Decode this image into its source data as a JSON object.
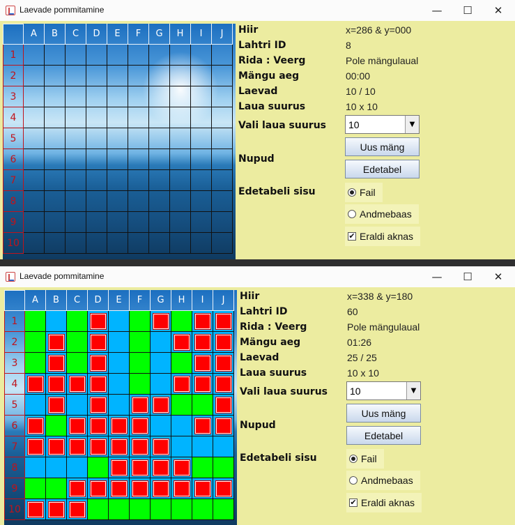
{
  "title": "Laevade pommitamine",
  "window_controls": {
    "minimize": "—",
    "maximize": "☐",
    "close": "✕"
  },
  "columns": [
    "A",
    "B",
    "C",
    "D",
    "E",
    "F",
    "G",
    "H",
    "I",
    "J"
  ],
  "rows": [
    "1",
    "2",
    "3",
    "4",
    "5",
    "6",
    "7",
    "8",
    "9",
    "10"
  ],
  "labels": {
    "mouse": "Hiir",
    "cell_id": "Lahtri ID",
    "row_col": "Rida : Veerg",
    "game_time": "Mängu aeg",
    "ships": "Laevad",
    "board_size": "Laua suurus",
    "choose_size": "Vali laua suurus",
    "buttons": "Nupud",
    "leaderboard_content": "Edetabeli sisu"
  },
  "buttons": {
    "new_game": "Uus mäng",
    "leaderboard": "Edetabel"
  },
  "options": {
    "file": "Fail",
    "database": "Andmebaas",
    "separate_window": "Eraldi aknas"
  },
  "windows": [
    {
      "mouse": "x=286 & y=000",
      "cell_id": "8",
      "row_col": "Pole mängulaual",
      "game_time": "00:00",
      "ships": "10 / 10",
      "board_size": "10 x 10",
      "size_selected": "10",
      "grid": null
    },
    {
      "mouse": "x=338 & y=180",
      "cell_id": "60",
      "row_col": "Pole mängulaual",
      "game_time": "01:26",
      "ships": "25 / 25",
      "board_size": "10 x 10",
      "size_selected": "10",
      "grid": [
        "GBGHBGHGHH",
        "GHGHBGBHHH",
        "GHGHBGBGHH",
        "HHHHBGBHHH",
        "BHBHBHHGGH",
        "HGHHHHBBHH",
        "HHHHHHHBBB",
        "BBBGHHHHGG",
        "GGHHHHHHHH",
        "HHHGGGGGGG"
      ]
    }
  ],
  "colors": {
    "ship_green": "#00ff00",
    "water_blue": "#00b4ff",
    "hit_red": "#ff0000",
    "row_header": "#c0131b",
    "panel_bg": "#ececa0"
  }
}
